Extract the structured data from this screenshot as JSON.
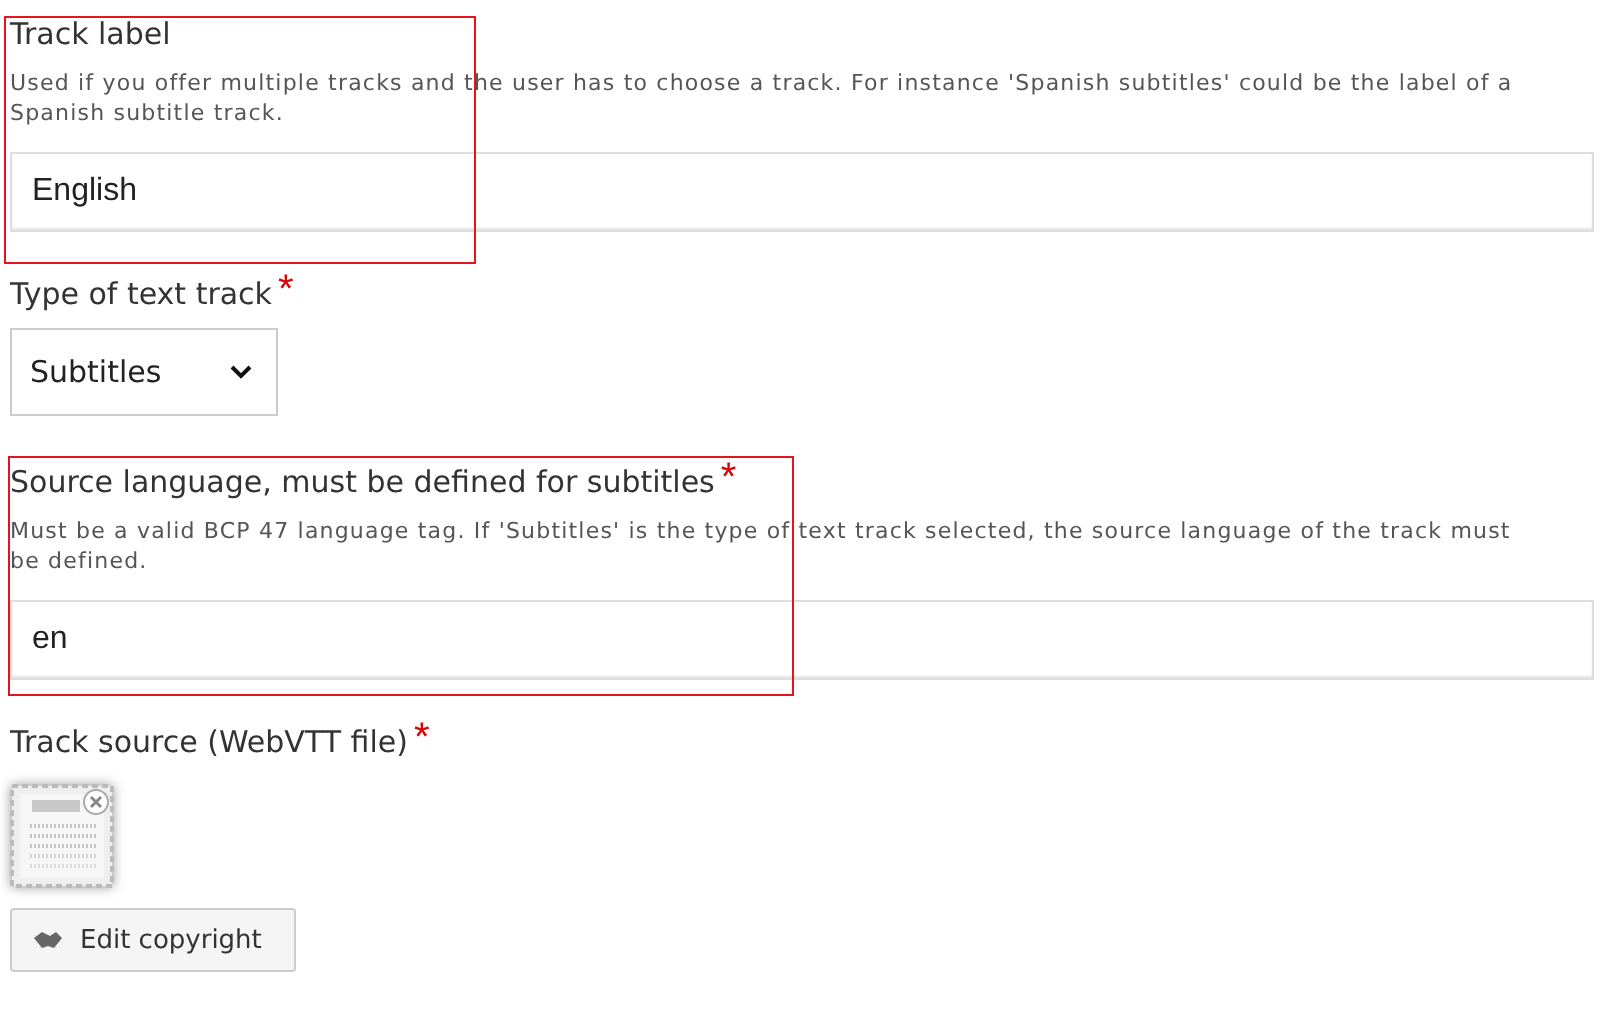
{
  "fields": [
    {
      "kind": "text",
      "label": "Track label",
      "description": "Used if you offer multiple tracks and the user has to choose a track. For instance 'Spanish subtitles' could be the label of a Spanish subtitle track.",
      "value": "English",
      "highlighted": true
    },
    {
      "kind": "select",
      "label": "Type of text track",
      "required_mark": "*",
      "value": "Subtitles"
    },
    {
      "kind": "text",
      "label": "Source language, must be defined for subtitles",
      "required_mark": "*",
      "description": "Must be a valid BCP 47 language tag. If 'Subtitles' is the type of text track selected, the source language of the track must be defined.",
      "value": "en",
      "highlighted": true
    },
    {
      "kind": "file",
      "label": "Track source (WebVTT file)",
      "required_mark": "*",
      "button": "Edit copyright"
    }
  ]
}
